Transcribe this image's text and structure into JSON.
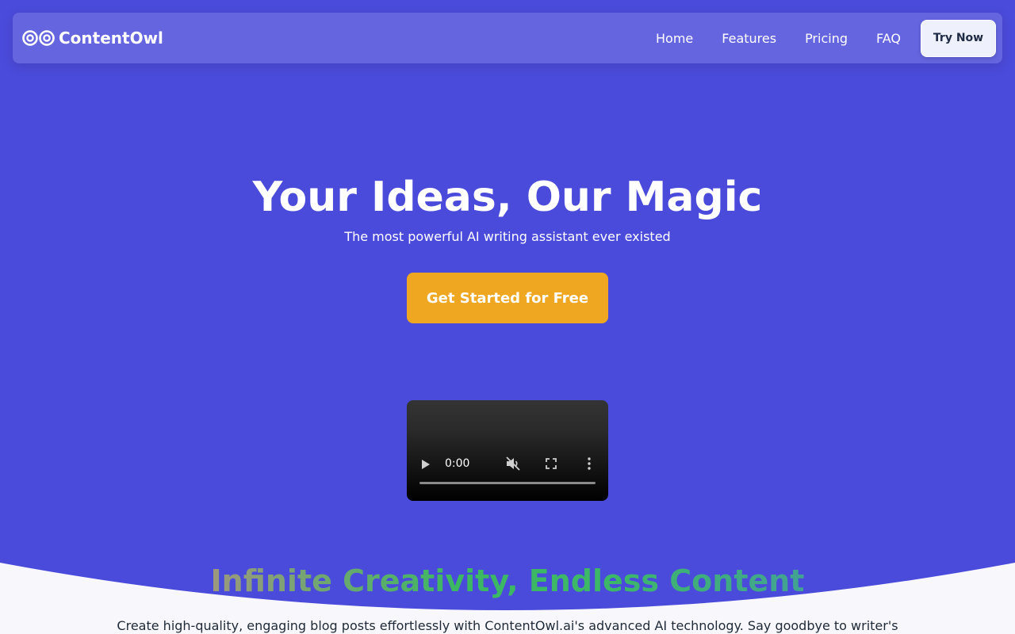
{
  "colors": {
    "hero_bg": "#4b4bdb",
    "accent": "#efa620",
    "page_bg": "#f8f8fc"
  },
  "navbar": {
    "brand": "ContentOwl",
    "brand_icon": "owl-eyes-icon",
    "links": [
      "Home",
      "Features",
      "Pricing",
      "FAQ"
    ],
    "cta": "Try Now"
  },
  "hero": {
    "title": "Your Ideas, Our Magic",
    "subtitle": "The most powerful AI writing assistant ever existed",
    "cta": "Get Started for Free"
  },
  "video": {
    "time": "0:00",
    "muted": true,
    "progress": 0
  },
  "section": {
    "title": "Infinite Creativity, Endless Content",
    "text": "Create high-quality, engaging blog posts effortlessly with ContentOwl.ai's advanced AI technology. Say goodbye to writer's"
  }
}
